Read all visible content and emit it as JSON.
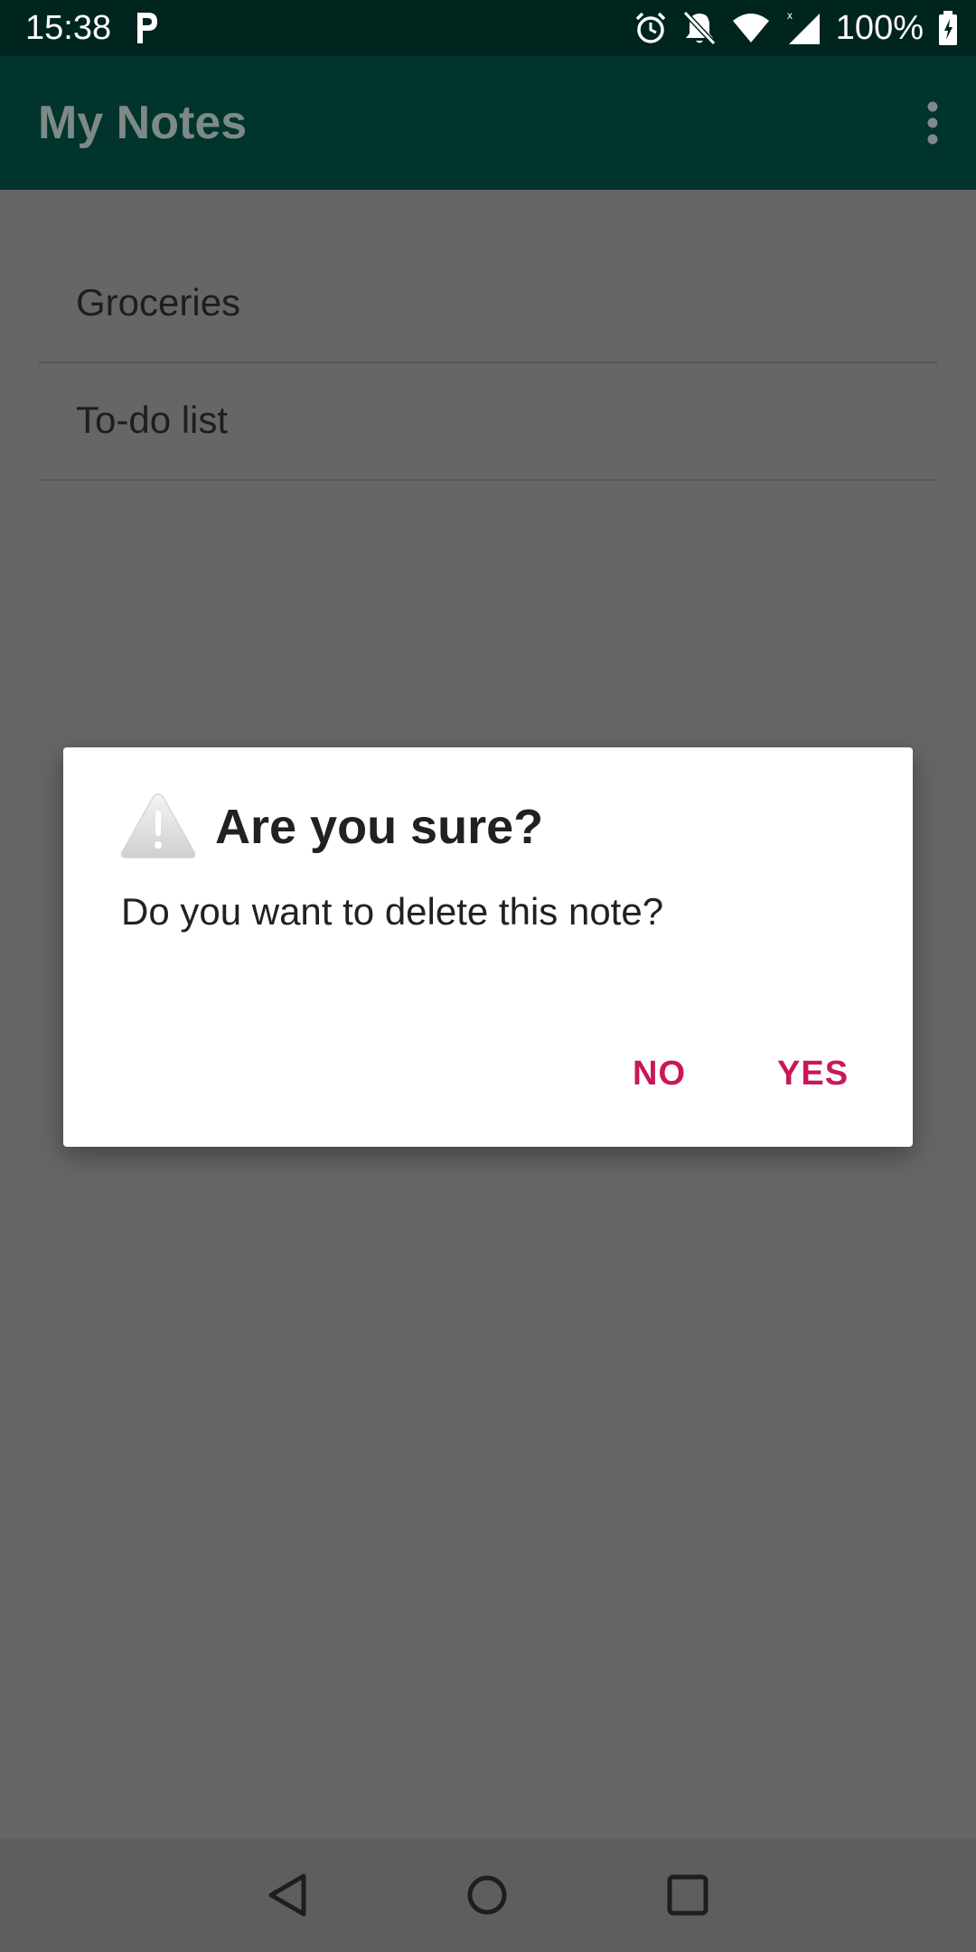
{
  "status_bar": {
    "time": "15:38",
    "battery_percent": "100%",
    "icons": [
      "parking-icon",
      "alarm-icon",
      "bell-off-icon",
      "wifi-icon",
      "signal-icon",
      "battery-charging-icon"
    ]
  },
  "app_bar": {
    "title": "My Notes",
    "overflow_icon": "more-vert-icon"
  },
  "notes": [
    {
      "label": "Groceries"
    },
    {
      "label": "To-do list"
    }
  ],
  "dialog": {
    "icon": "warning-icon",
    "title": "Are you sure?",
    "message": "Do you want to delete this note?",
    "no_label": "NO",
    "yes_label": "YES"
  },
  "nav_bar": {
    "icons": [
      "back-icon",
      "home-icon",
      "recents-icon"
    ]
  },
  "colors": {
    "status_bar": "#00241e",
    "app_bar": "#00342c",
    "scrim": "#666666",
    "accent": "#c8185a"
  }
}
